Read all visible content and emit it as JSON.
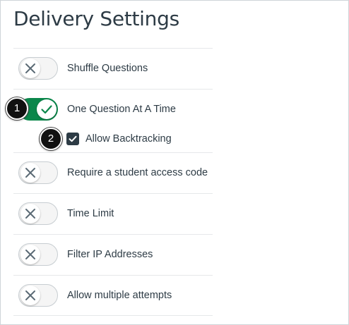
{
  "page": {
    "title": "Delivery Settings"
  },
  "settings": [
    {
      "label": "Shuffle Questions",
      "enabled": false,
      "icon": "x-icon"
    },
    {
      "label": "One Question At A Time",
      "enabled": true,
      "icon": "checkmark-icon"
    },
    {
      "label": "Require a student access code",
      "enabled": false,
      "icon": "x-icon"
    },
    {
      "label": "Time Limit",
      "enabled": false,
      "icon": "x-icon"
    },
    {
      "label": "Filter IP Addresses",
      "enabled": false,
      "icon": "x-icon"
    },
    {
      "label": "Allow multiple attempts",
      "enabled": false,
      "icon": "x-icon"
    }
  ],
  "sub_option": {
    "label": "Allow Backtracking",
    "checked": true,
    "icon": "checkmark-icon"
  },
  "callouts": [
    "1",
    "2"
  ],
  "colors": {
    "text": "#2d3b45",
    "toggle_on": "#0b874b",
    "toggle_off_bg": "#f5f5f5",
    "toggle_off_border": "#c7cdd1",
    "off_icon": "#5b6a75",
    "checkbox_bg": "#2d3b45",
    "callout_bg": "#111111"
  }
}
